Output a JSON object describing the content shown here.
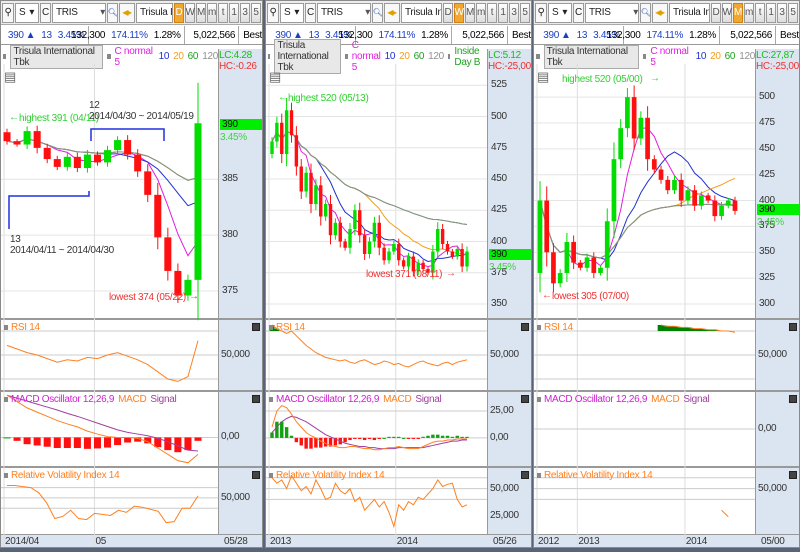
{
  "colors": {
    "ma5": "#e020e0",
    "ma10": "#2030d0",
    "ma20": "#f0a020",
    "ma60": "#20a020",
    "ma120": "#909090",
    "up": "#00dd00",
    "down": "#ff1010",
    "macd": "#ff8020",
    "signal": "#a040a0",
    "rsi": "#ff8020",
    "rvi": "#ff8020",
    "active_period": "#f0a830"
  },
  "panels": [
    {
      "toolbar": {
        "market": "S",
        "type": "C",
        "code": "TRIS",
        "name": "Trisula Internatio",
        "periods": [
          "D",
          "W",
          "M",
          "m",
          "t",
          "1",
          "3",
          "5"
        ],
        "active_period": "D"
      },
      "quote": {
        "price": "390",
        "arrow": "▲",
        "change": "13",
        "change_pct": "3.45%",
        "volume": "132,300",
        "volume_ratio": "174.11%",
        "turnover": "1.28%",
        "value": "5,022,566",
        "best": "Best"
      },
      "header": {
        "title": "Trisula International Tbk",
        "ma_label": "C normal 5",
        "ma_periods": [
          "10",
          "20",
          "60",
          "120"
        ],
        "extra": "",
        "lc": "LC:4.28",
        "hc": "HC:-0.26"
      },
      "price": {
        "range": [
          372.5,
          395.3
        ],
        "ticks": [
          {
            "label": "385",
            "value": 385
          },
          {
            "label": "380",
            "value": 380
          },
          {
            "label": "375",
            "value": 375
          }
        ],
        "first_open": 389.2,
        "closes": [
          388.4,
          388.1,
          389.3,
          387.8,
          386.8,
          386.1,
          387.0,
          386.0,
          387.2,
          386.5,
          387.6,
          388.5,
          387.2,
          385.7,
          383.6,
          379.8,
          376.8,
          374.6,
          376.0,
          390.0
        ],
        "last_tag": "390",
        "last_pct": "3.45%"
      },
      "annotations": {
        "highest": "highest 391 (04/11)",
        "lowest": "lowest 374 (05/22)",
        "period_a_count": "12",
        "period_a": "2014/04/30 ~ 2014/05/19",
        "period_b_count": "13",
        "period_b": "2014/04/11 ~ 2014/04/30"
      },
      "rsi": {
        "label": "RSI 14",
        "tick": "50,000",
        "range": [
          20,
          80
        ],
        "values": [
          58,
          55,
          52,
          50,
          47,
          44,
          46,
          45,
          48,
          47,
          50,
          52,
          49,
          46,
          42,
          36,
          30,
          28,
          32,
          62
        ]
      },
      "macd": {
        "label": "MACD Oscillator 12,26,9",
        "macd_label": "MACD",
        "signal_label": "Signal",
        "ticks": [
          {
            "label": "0,00",
            "value": 0
          }
        ],
        "range": [
          -0.7,
          1.1
        ],
        "macd": [
          1.0,
          0.85,
          0.7,
          0.6,
          0.5,
          0.4,
          0.32,
          0.25,
          0.15,
          0.08,
          0.02,
          0,
          0,
          -0.02,
          -0.1,
          -0.25,
          -0.4,
          -0.55,
          -0.6,
          -0.4
        ],
        "signal": [
          1.0,
          0.93,
          0.86,
          0.79,
          0.72,
          0.65,
          0.57,
          0.5,
          0.42,
          0.34,
          0.26,
          0.18,
          0.12,
          0.08,
          0.04,
          -0.02,
          -0.1,
          -0.2,
          -0.3,
          -0.32
        ]
      },
      "rvi": {
        "label": "Relative Volatility Index 14",
        "ticks": [
          {
            "label": "50,000",
            "value": 50
          }
        ],
        "range": [
          15,
          80
        ],
        "values": [
          62,
          62,
          61,
          60,
          55,
          45,
          30,
          32,
          38,
          30,
          29,
          35,
          34,
          33,
          38,
          36,
          42,
          41,
          39,
          37,
          26,
          27,
          40,
          40,
          52
        ]
      },
      "dates": [
        {
          "label": "2014/04",
          "index": 0
        },
        {
          "label": "05",
          "index": 9
        }
      ],
      "date_end": "05/28"
    },
    {
      "toolbar": {
        "market": "S",
        "type": "C",
        "code": "TRIS",
        "name": "Trisula Internatio",
        "periods": [
          "D",
          "W",
          "M",
          "m",
          "t",
          "1",
          "3",
          "5"
        ],
        "active_period": "W"
      },
      "quote": {
        "price": "390",
        "arrow": "▲",
        "change": "13",
        "change_pct": "3.45%",
        "volume": "132,300",
        "volume_ratio": "174.11%",
        "turnover": "1.28%",
        "value": "5,022,566",
        "best": "Best"
      },
      "header": {
        "title": "Trisula International Tbk",
        "ma_label": "C normal 5",
        "ma_periods": [
          "10",
          "20",
          "60",
          "120"
        ],
        "extra": "Inside Day B",
        "lc": "LC:5.12",
        "hc": "HC:-25,00"
      },
      "price": {
        "range": [
          338,
          542
        ],
        "ticks": [
          {
            "label": "525",
            "value": 525
          },
          {
            "label": "500",
            "value": 500
          },
          {
            "label": "475",
            "value": 475
          },
          {
            "label": "450",
            "value": 450
          },
          {
            "label": "425",
            "value": 425
          },
          {
            "label": "400",
            "value": 400
          },
          {
            "label": "375",
            "value": 375
          },
          {
            "label": "350",
            "value": 350
          }
        ],
        "first_open": 470,
        "closes": [
          480,
          495,
          470,
          505,
          485,
          460,
          440,
          455,
          430,
          445,
          420,
          430,
          405,
          415,
          400,
          395,
          410,
          425,
          405,
          390,
          400,
          415,
          395,
          385,
          392,
          398,
          385,
          380,
          388,
          376,
          383,
          378,
          375,
          392,
          410,
          398,
          392,
          388,
          394,
          380,
          392
        ],
        "last_tag": "390",
        "last_pct": "3.45%"
      },
      "annotations": {
        "highest": "highest 520 (05/13)",
        "lowest": "lowest 371 (08/11)"
      },
      "rsi": {
        "label": "RSI 14",
        "tick": "50,000",
        "range": [
          20,
          80
        ],
        "values": [
          75,
          72,
          70,
          68,
          70,
          66,
          62,
          58,
          55,
          52,
          50,
          48,
          47,
          46,
          45,
          46,
          44,
          43,
          45,
          46,
          44,
          42,
          43,
          45,
          44,
          42,
          43,
          41,
          40,
          42,
          44,
          45,
          43,
          42,
          41,
          43,
          44,
          42,
          44,
          45,
          46
        ]
      },
      "macd": {
        "label": "MACD Oscillator 12,26,9",
        "macd_label": "MACD",
        "signal_label": "Signal",
        "ticks": [
          {
            "label": "25,00",
            "value": 25
          },
          {
            "label": "0,00",
            "value": 0
          }
        ],
        "range": [
          -27,
          43.5
        ],
        "macd": [
          10,
          25,
          30,
          28,
          22,
          15,
          10,
          5,
          2,
          0,
          -3,
          -5,
          -7,
          -8,
          -9,
          -9,
          -8,
          -8,
          -9,
          -10,
          -10,
          -11,
          -11,
          -10,
          -9,
          -9,
          -8,
          -9,
          -10,
          -10,
          -10,
          -8,
          -6,
          -4,
          -3,
          -3,
          -2,
          -2,
          -1,
          -1,
          -1
        ],
        "signal": [
          5,
          10,
          15,
          18,
          20,
          19,
          17,
          15,
          12,
          9,
          6,
          3,
          1,
          -1,
          -3,
          -5,
          -6,
          -7,
          -8,
          -8,
          -9,
          -9,
          -10,
          -10,
          -10,
          -10,
          -9,
          -9,
          -9,
          -9,
          -9,
          -9,
          -8,
          -7,
          -6,
          -5,
          -4,
          -3,
          -3,
          -2,
          -2
        ]
      },
      "rvi": {
        "label": "Relative Volatility Index 14",
        "ticks": [
          {
            "label": "50,000",
            "value": 50
          },
          {
            "label": "25,000",
            "value": 25
          }
        ],
        "range": [
          8,
          70
        ],
        "values": [
          60,
          55,
          58,
          50,
          62,
          55,
          48,
          52,
          45,
          58,
          50,
          40,
          42,
          55,
          48,
          45,
          50,
          38,
          42,
          30,
          35,
          40,
          33,
          38,
          28,
          15,
          35,
          30,
          38,
          35,
          42,
          40,
          45,
          50,
          58,
          52,
          54,
          55,
          40,
          33,
          35
        ]
      },
      "dates": [
        {
          "label": "2013",
          "index": 0
        },
        {
          "label": "2014",
          "index": 26
        }
      ],
      "date_end": "05/26"
    },
    {
      "toolbar": {
        "market": "S",
        "type": "C",
        "code": "TRIS",
        "name": "Trisula Internatio",
        "periods": [
          "D",
          "W",
          "M",
          "m",
          "t",
          "1",
          "3",
          "5"
        ],
        "active_period": "M"
      },
      "quote": {
        "price": "390",
        "arrow": "▲",
        "change": "13",
        "change_pct": "3.45%",
        "volume": "132,300",
        "volume_ratio": "174.11%",
        "turnover": "1.28%",
        "value": "5,022,566",
        "best": "Best"
      },
      "header": {
        "title": "Trisula International Tbk",
        "ma_label": "C normal 5",
        "ma_periods": [
          "10",
          "20",
          "60",
          "120"
        ],
        "extra": "",
        "lc": "LC:27,87",
        "hc": "HC:-25,00"
      },
      "price": {
        "range": [
          285.5,
          532
        ],
        "ticks": [
          {
            "label": "500",
            "value": 500
          },
          {
            "label": "475",
            "value": 475
          },
          {
            "label": "450",
            "value": 450
          },
          {
            "label": "425",
            "value": 425
          },
          {
            "label": "400",
            "value": 400
          },
          {
            "label": "375",
            "value": 375
          },
          {
            "label": "350",
            "value": 350
          },
          {
            "label": "325",
            "value": 325
          },
          {
            "label": "300",
            "value": 300
          }
        ],
        "first_open": 330,
        "closes": [
          400,
          350,
          320,
          330,
          360,
          340,
          335,
          345,
          330,
          335,
          380,
          440,
          470,
          500,
          460,
          480,
          440,
          430,
          420,
          410,
          420,
          400,
          410,
          395,
          405,
          400,
          385,
          395,
          400,
          390
        ],
        "last_tag": "390",
        "last_pct": "3.45%"
      },
      "annotations": {
        "highest": "highest 520 (05/00)",
        "lowest": "lowest 305 (07/00)"
      },
      "rsi": {
        "label": "RSI 14",
        "tick": "50,000",
        "range": [
          20,
          80
        ],
        "values": [
          null,
          null,
          null,
          null,
          null,
          null,
          null,
          null,
          null,
          null,
          null,
          null,
          null,
          null,
          null,
          null,
          null,
          null,
          75,
          74,
          74,
          73,
          73,
          72,
          72,
          71,
          71,
          70,
          70,
          69
        ]
      },
      "macd": {
        "label": "MACD Oscillator 12,26,9",
        "macd_label": "MACD",
        "signal_label": "Signal",
        "ticks": [
          {
            "label": "0,00",
            "value": 0
          }
        ],
        "range": [
          -1,
          1
        ],
        "macd": [],
        "signal": []
      },
      "rvi": {
        "label": "Relative Volatility Index 14",
        "ticks": [
          {
            "label": "50,000",
            "value": 50
          }
        ],
        "range": [
          8,
          70
        ],
        "values": [
          null,
          null,
          null,
          null,
          null,
          null,
          null,
          null,
          null,
          null,
          null,
          null,
          null,
          null,
          null,
          null,
          null,
          null,
          null,
          null,
          null,
          null,
          null,
          null,
          null,
          null,
          null,
          30,
          24
        ]
      },
      "dates": [
        {
          "label": "2012",
          "index": 0
        },
        {
          "label": "2013",
          "index": 6
        },
        {
          "label": "2014",
          "index": 22
        }
      ],
      "date_end": "05/00"
    }
  ]
}
